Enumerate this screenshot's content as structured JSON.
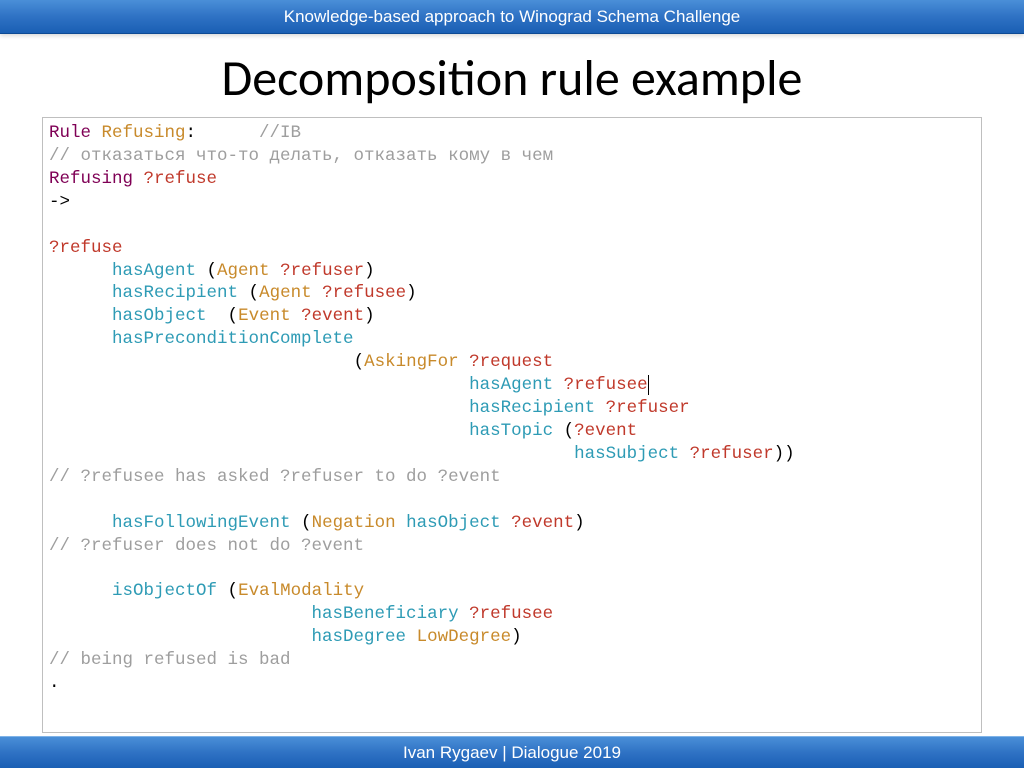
{
  "header": {
    "title": "Knowledge-based approach to Winograd  Schema Challenge"
  },
  "slide": {
    "title": "Decomposition rule example"
  },
  "footer": {
    "text": "Ivan Rygaev  | Dialogue 2019"
  },
  "code": {
    "l01": {
      "a": "Rule ",
      "b": "Refusing",
      "c": ":      ",
      "d": "//IB"
    },
    "l02": "// отказаться что-то делать, отказать кому в чем",
    "l03": {
      "a": "Refusing ",
      "b": "?refuse"
    },
    "l04": "->",
    "l05": "",
    "l06": "?refuse",
    "l07": {
      "ind": "      ",
      "a": "hasAgent ",
      "p": "(",
      "b": "Agent ",
      "c": "?refuser",
      "q": ")"
    },
    "l08": {
      "ind": "      ",
      "a": "hasRecipient ",
      "p": "(",
      "b": "Agent ",
      "c": "?refusee",
      "q": ")"
    },
    "l09": {
      "ind": "      ",
      "a": "hasObject  ",
      "p": "(",
      "b": "Event ",
      "c": "?event",
      "q": ")"
    },
    "l10": {
      "ind": "      ",
      "a": "hasPreconditionComplete"
    },
    "l11": {
      "ind": "                             ",
      "p": "(",
      "b": "AskingFor ",
      "c": "?request"
    },
    "l12": {
      "ind": "                                        ",
      "a": "hasAgent ",
      "c": "?refusee"
    },
    "l13": {
      "ind": "                                        ",
      "a": "hasRecipient ",
      "c": "?refuser"
    },
    "l14": {
      "ind": "                                        ",
      "a": "hasTopic ",
      "p": "(",
      "c": "?event"
    },
    "l15": {
      "ind": "                                                  ",
      "a": "hasSubject ",
      "c": "?refuser",
      "q": "))"
    },
    "l16": "// ?refusee has asked ?refuser to do ?event",
    "l17": "",
    "l18": {
      "ind": "      ",
      "a": "hasFollowingEvent ",
      "p": "(",
      "b": "Negation ",
      "a2": "hasObject ",
      "c": "?event",
      "q": ")"
    },
    "l19": "// ?refuser does not do ?event",
    "l20": "",
    "l21": {
      "ind": "      ",
      "a": "isObjectOf ",
      "p": "(",
      "b": "EvalModality"
    },
    "l22": {
      "ind": "                         ",
      "a": "hasBeneficiary ",
      "c": "?refusee"
    },
    "l23": {
      "ind": "                         ",
      "a": "hasDegree ",
      "b": "LowDegree",
      "q": ")"
    },
    "l24": "// being refused is bad",
    "l25": "."
  }
}
